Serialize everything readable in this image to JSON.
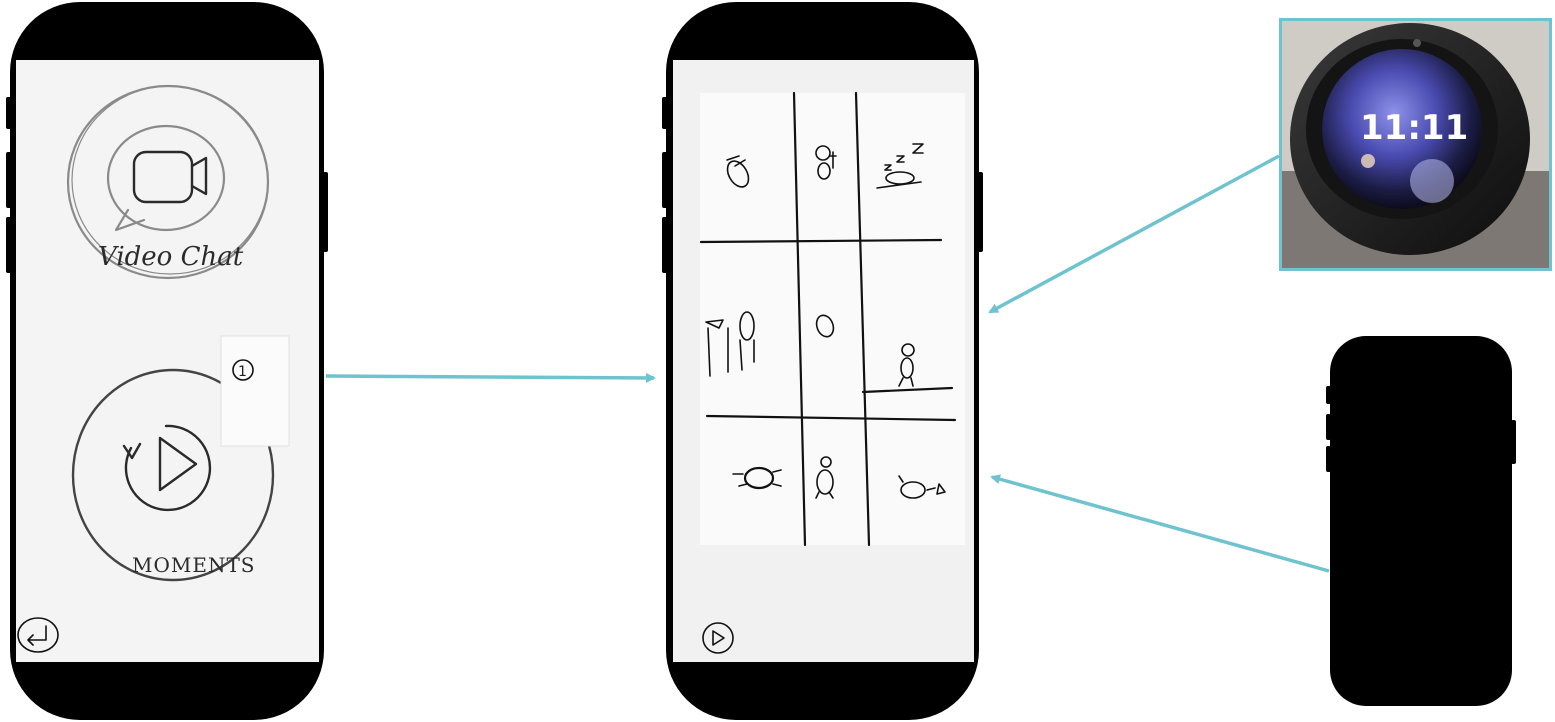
{
  "home_sketch": {
    "video_chat_label": "Video Chat",
    "moments_label": "MOMENTS",
    "badge_count": "1"
  },
  "device_photo": {
    "clock_time": "11:11"
  },
  "colors": {
    "arrow": "#6ec3cf",
    "phone_body": "#000000"
  },
  "icons": [
    "video-camera-icon",
    "speech-bubble-icon",
    "replay-play-icon",
    "back-arrow-icon",
    "play-icon"
  ]
}
